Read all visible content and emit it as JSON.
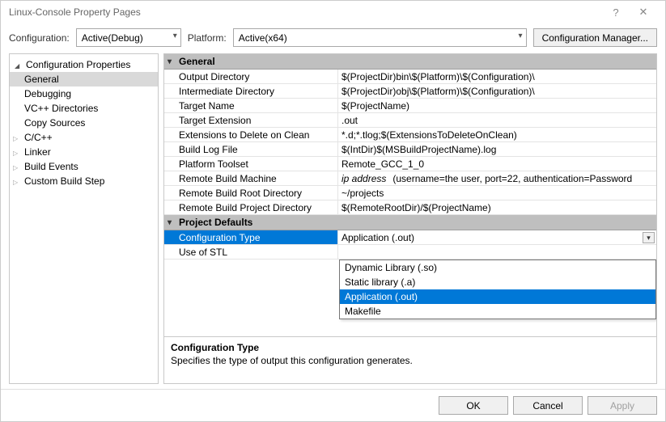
{
  "window": {
    "title": "Linux-Console Property Pages"
  },
  "cfgbar": {
    "config_label": "Configuration:",
    "config_value": "Active(Debug)",
    "platform_label": "Platform:",
    "platform_value": "Active(x64)",
    "manager_btn": "Configuration Manager..."
  },
  "nav": {
    "root": "Configuration Properties",
    "items": [
      "General",
      "Debugging",
      "VC++ Directories",
      "Copy Sources",
      "C/C++",
      "Linker",
      "Build Events",
      "Custom Build Step"
    ],
    "selected": "General",
    "expandable": [
      "C/C++",
      "Linker",
      "Build Events",
      "Custom Build Step"
    ]
  },
  "sections": [
    {
      "title": "General",
      "rows": [
        {
          "label": "Output Directory",
          "value": "$(ProjectDir)bin\\$(Platform)\\$(Configuration)\\"
        },
        {
          "label": "Intermediate Directory",
          "value": "$(ProjectDir)obj\\$(Platform)\\$(Configuration)\\"
        },
        {
          "label": "Target Name",
          "value": "$(ProjectName)"
        },
        {
          "label": "Target Extension",
          "value": ".out"
        },
        {
          "label": "Extensions to Delete on Clean",
          "value": "*.d;*.tlog;$(ExtensionsToDeleteOnClean)"
        },
        {
          "label": "Build Log File",
          "value": "$(IntDir)$(MSBuildProjectName).log"
        },
        {
          "label": "Platform Toolset",
          "value": "Remote_GCC_1_0"
        },
        {
          "label": "Remote Build Machine",
          "value_html": true,
          "ip": "ip address",
          "rest": "(username=the user, port=22, authentication=Password"
        },
        {
          "label": "Remote Build Root Directory",
          "value": "~/projects"
        },
        {
          "label": "Remote Build Project Directory",
          "value": "$(RemoteRootDir)/$(ProjectName)"
        }
      ]
    },
    {
      "title": "Project Defaults",
      "rows": [
        {
          "label": "Configuration Type",
          "value": "Application (.out)",
          "selected": true
        },
        {
          "label": "Use of STL",
          "value": ""
        }
      ]
    }
  ],
  "dropdown": {
    "options": [
      "Dynamic Library (.so)",
      "Static library (.a)",
      "Application (.out)",
      "Makefile"
    ],
    "highlighted": "Application (.out)"
  },
  "desc": {
    "title": "Configuration Type",
    "text": "Specifies the type of output this configuration generates."
  },
  "footer": {
    "ok": "OK",
    "cancel": "Cancel",
    "apply": "Apply"
  }
}
